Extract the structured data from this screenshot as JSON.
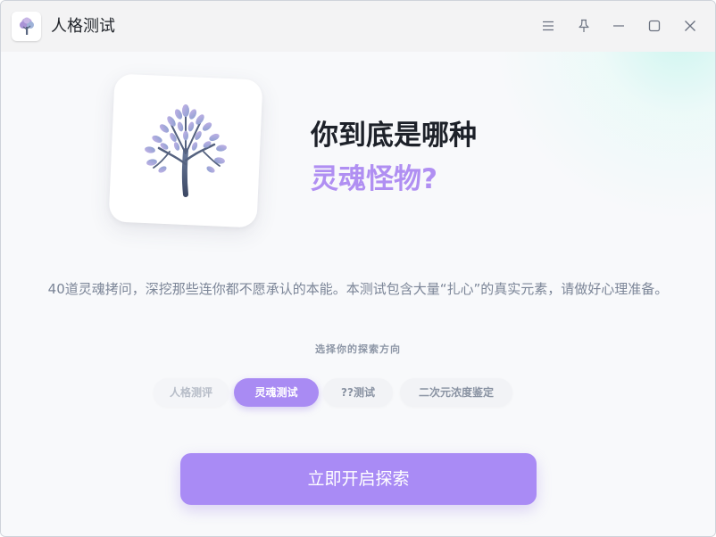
{
  "window": {
    "title": "人格测试",
    "icons": {
      "app": "tree-icon",
      "menu": "menu-icon",
      "pin": "pin-icon",
      "minimize": "minimize-icon",
      "maximize": "maximize-icon",
      "close": "close-icon"
    }
  },
  "hero": {
    "icon": "tree-icon",
    "headline_line1": "你到底是哪种",
    "headline_line2": "灵魂怪物?"
  },
  "description": "40道灵魂拷问，深挖那些连你都不愿承认的本能。本测试包含大量“扎心”的真实元素，请做好心理准备。",
  "direction": {
    "label": "选择你的探索方向",
    "options": [
      {
        "label": "人格测评",
        "selected": false
      },
      {
        "label": "灵魂测试",
        "selected": true
      },
      {
        "label": "??测试",
        "selected": false
      },
      {
        "label": "二次元浓度鉴定",
        "selected": false
      }
    ]
  },
  "start_button": {
    "label": "立即开启探索"
  },
  "colors": {
    "accent": "#a98bf3",
    "headline_accent": "#b08ff2",
    "text_dark": "#1d2129",
    "text_muted": "#7b8597"
  }
}
